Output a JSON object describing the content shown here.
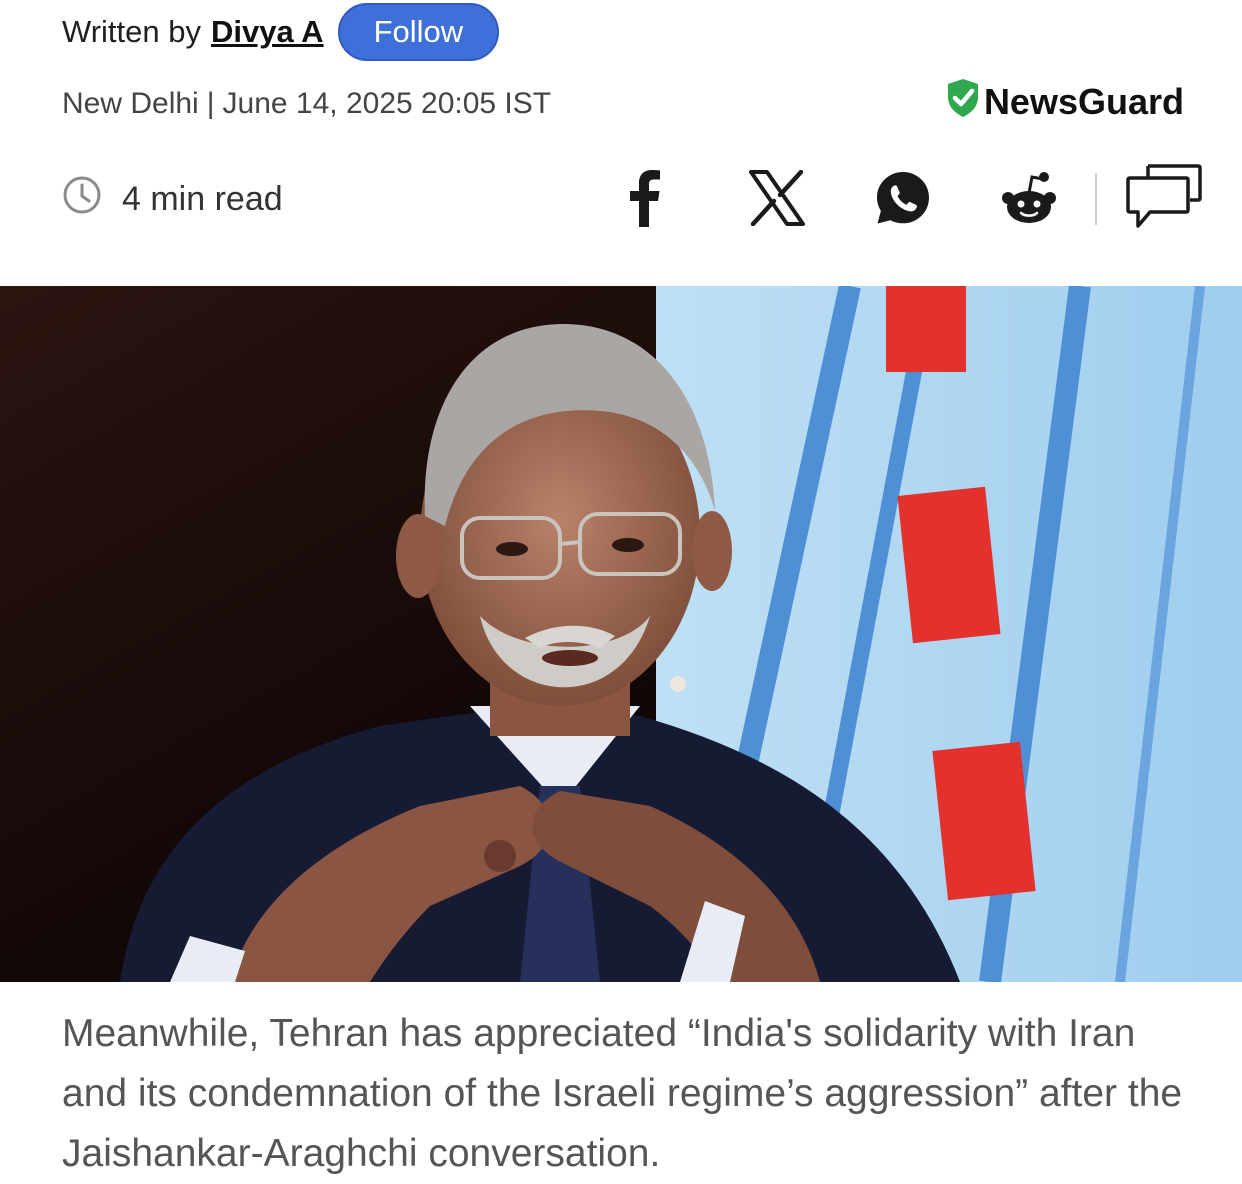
{
  "byline": {
    "prefix": "Written by",
    "author": "Divya A",
    "follow_label": "Follow"
  },
  "dateline": {
    "location": "New Delhi",
    "separator": "|",
    "datetime": "June 14, 2025 20:05 IST"
  },
  "newsguard": {
    "label": "NewsGuard",
    "icon": "shield-check-icon",
    "color": "#2fa84f"
  },
  "read_time": {
    "icon": "clock-icon",
    "label": "4 min read"
  },
  "share": {
    "buttons": [
      "facebook-icon",
      "x-icon",
      "whatsapp-icon",
      "reddit-icon",
      "comments-icon"
    ]
  },
  "colors": {
    "follow_button": "#3f6fd8",
    "body_text": "#555555"
  },
  "article": {
    "paragraph": "Meanwhile, Tehran has appreciated “India's solidarity with Iran and its condemnation of the Israeli regime’s aggression” after the Jaishankar-Araghchi conversation."
  }
}
